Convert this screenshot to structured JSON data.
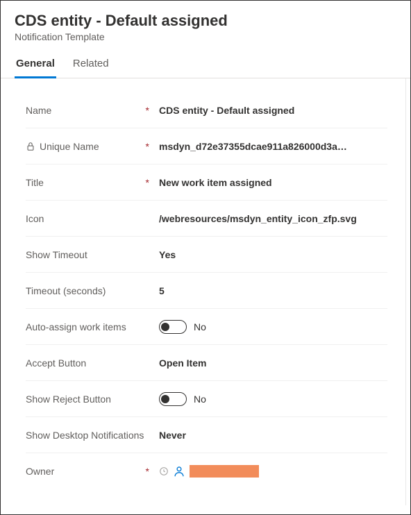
{
  "header": {
    "title": "CDS entity - Default assigned",
    "subtitle": "Notification Template"
  },
  "tabs": {
    "general": "General",
    "related": "Related"
  },
  "fields": {
    "name": {
      "label": "Name",
      "value": "CDS entity - Default assigned"
    },
    "uniqueName": {
      "label": "Unique Name",
      "value": "msdyn_d72e37355dcae911a826000d3a…"
    },
    "title": {
      "label": "Title",
      "value": "New work item assigned"
    },
    "icon": {
      "label": "Icon",
      "value": "/webresources/msdyn_entity_icon_zfp.svg"
    },
    "showTimeout": {
      "label": "Show Timeout",
      "value": "Yes"
    },
    "timeout": {
      "label": "Timeout (seconds)",
      "value": "5"
    },
    "autoAssign": {
      "label": "Auto-assign work items",
      "toggleText": "No"
    },
    "acceptButton": {
      "label": "Accept Button",
      "value": "Open Item"
    },
    "showReject": {
      "label": "Show Reject Button",
      "toggleText": "No"
    },
    "showDesktop": {
      "label": "Show Desktop Notifications",
      "value": "Never"
    },
    "owner": {
      "label": "Owner"
    }
  },
  "required_marker": "*"
}
